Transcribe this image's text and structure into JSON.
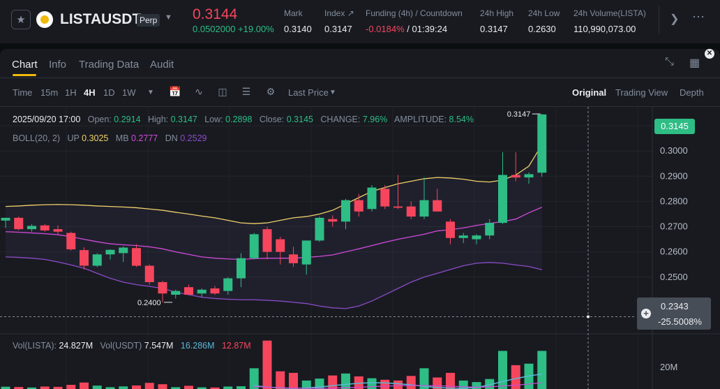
{
  "header": {
    "symbol": "LISTAUSDT",
    "contract_type": "Perp",
    "last_price": "0.3144",
    "price_change": "0.0502000 +19.00%",
    "stats": [
      {
        "label": "Mark",
        "value": "0.3140"
      },
      {
        "label": "Index ↗",
        "value": "0.3147"
      },
      {
        "label": "Funding (4h) / Countdown",
        "value_red": "-0.0184%",
        "value_rest": " / 01:39:24"
      },
      {
        "label": "24h High",
        "value": "0.3147"
      },
      {
        "label": "24h Low",
        "value": "0.2630"
      },
      {
        "label": "24h Volume(LISTA)",
        "value": "110,990,073.00"
      }
    ]
  },
  "tabs": [
    "Chart",
    "Info",
    "Trading Data",
    "Audit"
  ],
  "toolbar": {
    "time_label": "Time",
    "intervals": [
      "15m",
      "1H",
      "4H",
      "1D",
      "1W"
    ],
    "active_interval": "4H",
    "price_type": "Last Price",
    "views": [
      "Original",
      "Trading View",
      "Depth"
    ],
    "active_view": "Original"
  },
  "ohlc": {
    "date": "2025/09/20 17:00",
    "open_label": "Open:",
    "open": "0.2914",
    "high_label": "High:",
    "high": "0.3147",
    "low_label": "Low:",
    "low": "0.2898",
    "close_label": "Close:",
    "close": "0.3145",
    "change_label": "CHANGE:",
    "change": "7.96%",
    "amplitude_label": "AMPLITUDE:",
    "amplitude": "8.54%"
  },
  "boll": {
    "name": "BOLL(20, 2)",
    "up_label": "UP",
    "up": "0.3025",
    "mb_label": "MB",
    "mb": "0.2777",
    "dn_label": "DN",
    "dn": "0.2529"
  },
  "volume": {
    "lista_label": "Vol(LISTA):",
    "lista": "24.827M",
    "usdt_label": "Vol(USDT)",
    "usdt": "7.547M",
    "ma1": "16.286M",
    "ma2": "12.87M",
    "axis_label": "20M"
  },
  "price_tag": "0.3145",
  "crosshair": {
    "price": "0.2343",
    "pct": "-25.5008%"
  },
  "colors": {
    "up": "#2ebd85",
    "down": "#f6465d",
    "boll_up": "#f0d06a",
    "boll_mb": "#d04bd8",
    "boll_dn": "#8c4cc9",
    "accent": "#f0b90b"
  },
  "chart_data": {
    "type": "candlestick",
    "interval": "4H",
    "y_ticks": [
      0.31,
      0.3,
      0.29,
      0.28,
      0.27,
      0.26,
      0.25
    ],
    "ylim": [
      0.2275,
      0.3175
    ],
    "annotations": {
      "high": "0.3147",
      "low": "0.2400"
    },
    "candles": [
      {
        "o": 0.2724,
        "h": 0.2735,
        "l": 0.2695,
        "c": 0.2735
      },
      {
        "o": 0.2735,
        "h": 0.274,
        "l": 0.2685,
        "c": 0.269
      },
      {
        "o": 0.269,
        "h": 0.271,
        "l": 0.268,
        "c": 0.2703
      },
      {
        "o": 0.2705,
        "h": 0.271,
        "l": 0.268,
        "c": 0.2685
      },
      {
        "o": 0.269,
        "h": 0.2705,
        "l": 0.267,
        "c": 0.268
      },
      {
        "o": 0.2675,
        "h": 0.268,
        "l": 0.2605,
        "c": 0.261
      },
      {
        "o": 0.2607,
        "h": 0.2618,
        "l": 0.253,
        "c": 0.2545
      },
      {
        "o": 0.2545,
        "h": 0.2595,
        "l": 0.254,
        "c": 0.259
      },
      {
        "o": 0.259,
        "h": 0.261,
        "l": 0.257,
        "c": 0.2608
      },
      {
        "o": 0.2595,
        "h": 0.2622,
        "l": 0.256,
        "c": 0.2617
      },
      {
        "o": 0.2615,
        "h": 0.263,
        "l": 0.254,
        "c": 0.2545
      },
      {
        "o": 0.2545,
        "h": 0.255,
        "l": 0.247,
        "c": 0.248
      },
      {
        "o": 0.248,
        "h": 0.2485,
        "l": 0.24,
        "c": 0.2435
      },
      {
        "o": 0.243,
        "h": 0.245,
        "l": 0.2415,
        "c": 0.2445
      },
      {
        "o": 0.246,
        "h": 0.247,
        "l": 0.243,
        "c": 0.243
      },
      {
        "o": 0.2435,
        "h": 0.2455,
        "l": 0.242,
        "c": 0.245
      },
      {
        "o": 0.2455,
        "h": 0.2465,
        "l": 0.243,
        "c": 0.2435
      },
      {
        "o": 0.2445,
        "h": 0.25,
        "l": 0.243,
        "c": 0.2495
      },
      {
        "o": 0.2495,
        "h": 0.2595,
        "l": 0.246,
        "c": 0.2575
      },
      {
        "o": 0.2575,
        "h": 0.2675,
        "l": 0.257,
        "c": 0.267
      },
      {
        "o": 0.269,
        "h": 0.27,
        "l": 0.257,
        "c": 0.26
      },
      {
        "o": 0.265,
        "h": 0.266,
        "l": 0.255,
        "c": 0.26
      },
      {
        "o": 0.259,
        "h": 0.262,
        "l": 0.254,
        "c": 0.2555
      },
      {
        "o": 0.255,
        "h": 0.264,
        "l": 0.251,
        "c": 0.2645
      },
      {
        "o": 0.2645,
        "h": 0.274,
        "l": 0.264,
        "c": 0.2735
      },
      {
        "o": 0.273,
        "h": 0.2745,
        "l": 0.27,
        "c": 0.272
      },
      {
        "o": 0.272,
        "h": 0.281,
        "l": 0.269,
        "c": 0.2805
      },
      {
        "o": 0.2805,
        "h": 0.283,
        "l": 0.274,
        "c": 0.276
      },
      {
        "o": 0.277,
        "h": 0.2865,
        "l": 0.276,
        "c": 0.2855
      },
      {
        "o": 0.285,
        "h": 0.2865,
        "l": 0.277,
        "c": 0.278
      },
      {
        "o": 0.278,
        "h": 0.2905,
        "l": 0.277,
        "c": 0.2775
      },
      {
        "o": 0.278,
        "h": 0.28,
        "l": 0.273,
        "c": 0.274
      },
      {
        "o": 0.274,
        "h": 0.2895,
        "l": 0.273,
        "c": 0.2805
      },
      {
        "o": 0.2805,
        "h": 0.285,
        "l": 0.278,
        "c": 0.276
      },
      {
        "o": 0.272,
        "h": 0.273,
        "l": 0.263,
        "c": 0.2655
      },
      {
        "o": 0.2655,
        "h": 0.2675,
        "l": 0.2635,
        "c": 0.2665
      },
      {
        "o": 0.265,
        "h": 0.267,
        "l": 0.263,
        "c": 0.2665
      },
      {
        "o": 0.2665,
        "h": 0.273,
        "l": 0.265,
        "c": 0.2715
      },
      {
        "o": 0.2715,
        "h": 0.2995,
        "l": 0.271,
        "c": 0.2905
      },
      {
        "o": 0.2905,
        "h": 0.2995,
        "l": 0.288,
        "c": 0.2895
      },
      {
        "o": 0.2895,
        "h": 0.2915,
        "l": 0.287,
        "c": 0.2908
      },
      {
        "o": 0.2914,
        "h": 0.3147,
        "l": 0.2898,
        "c": 0.3145
      }
    ],
    "boll_up": [
      0.278,
      0.2782,
      0.2785,
      0.2787,
      0.2788,
      0.2787,
      0.2785,
      0.2782,
      0.278,
      0.2778,
      0.2775,
      0.277,
      0.2765,
      0.2757,
      0.275,
      0.2742,
      0.2735,
      0.2725,
      0.2715,
      0.2712,
      0.2715,
      0.2725,
      0.2735,
      0.274,
      0.275,
      0.2765,
      0.279,
      0.2815,
      0.284,
      0.2855,
      0.287,
      0.288,
      0.289,
      0.2895,
      0.2893,
      0.2888,
      0.288,
      0.2877,
      0.2885,
      0.2905,
      0.294,
      0.3025
    ],
    "boll_mb": [
      0.268,
      0.2678,
      0.2675,
      0.2672,
      0.2668,
      0.266,
      0.265,
      0.264,
      0.2632,
      0.2628,
      0.2625,
      0.262,
      0.2612,
      0.26,
      0.259,
      0.258,
      0.2575,
      0.2572,
      0.257,
      0.2573,
      0.2575,
      0.2575,
      0.2575,
      0.2578,
      0.2582,
      0.2588,
      0.26,
      0.2612,
      0.2625,
      0.2638,
      0.265,
      0.266,
      0.267,
      0.2683,
      0.2688,
      0.2695,
      0.2705,
      0.2713,
      0.272,
      0.273,
      0.2755,
      0.2777
    ],
    "boll_dn": [
      0.258,
      0.2578,
      0.2575,
      0.257,
      0.256,
      0.2548,
      0.2535,
      0.2515,
      0.2495,
      0.248,
      0.247,
      0.2463,
      0.2455,
      0.244,
      0.243,
      0.242,
      0.2415,
      0.2412,
      0.241,
      0.241,
      0.2408,
      0.2405,
      0.24,
      0.2395,
      0.2385,
      0.2378,
      0.2375,
      0.2385,
      0.2405,
      0.243,
      0.2455,
      0.248,
      0.25,
      0.2515,
      0.253,
      0.2545,
      0.2555,
      0.2558,
      0.2555,
      0.2548,
      0.2542,
      0.2529
    ],
    "volume_values": [
      1.5,
      1.3,
      1.0,
      1.6,
      1.4,
      2.7,
      4.2,
      2.2,
      1.2,
      1.7,
      2.3,
      4.0,
      3.1,
      1.2,
      2.1,
      1.1,
      1.0,
      1.6,
      1.8,
      13.5,
      31.5,
      11.5,
      10.5,
      5.5,
      6.8,
      8.8,
      10.1,
      8.2,
      7.0,
      6.0,
      5.5,
      8.5,
      13.5,
      7.5,
      10.5,
      5.5,
      4.5,
      6.5,
      24.8,
      15.5,
      16.5,
      24.8
    ],
    "volume_ma_usdt": [
      16.286
    ],
    "volume_ma_lista": [
      12.87
    ]
  }
}
